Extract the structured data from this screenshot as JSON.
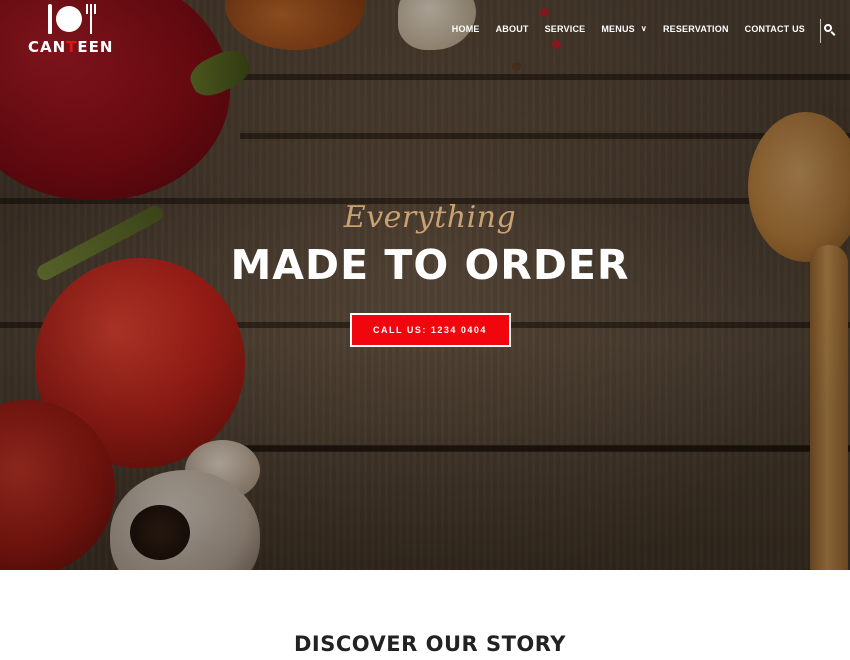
{
  "brand": {
    "logo_text_before": "CAN",
    "logo_text_accent": "T",
    "logo_text_after": "EEN",
    "logo_icon": "plate-cutlery-icon",
    "accent_color": "#e1141a"
  },
  "nav": {
    "items": [
      {
        "label": "HOME"
      },
      {
        "label": "ABOUT"
      },
      {
        "label": "SERVICE"
      },
      {
        "label": "MENUS",
        "icon": "chevron-down-icon"
      },
      {
        "label": "RESERVATION"
      },
      {
        "label": "CONTACT US"
      }
    ],
    "search_icon": "search-icon"
  },
  "hero": {
    "script_text": "Everything",
    "headline": "MADE TO ORDER",
    "cta_label": "CALL US: 1234 0404",
    "cta_color": "#f2060d",
    "script_color": "#c9a273"
  },
  "story": {
    "title": "DISCOVER OUR STORY"
  }
}
